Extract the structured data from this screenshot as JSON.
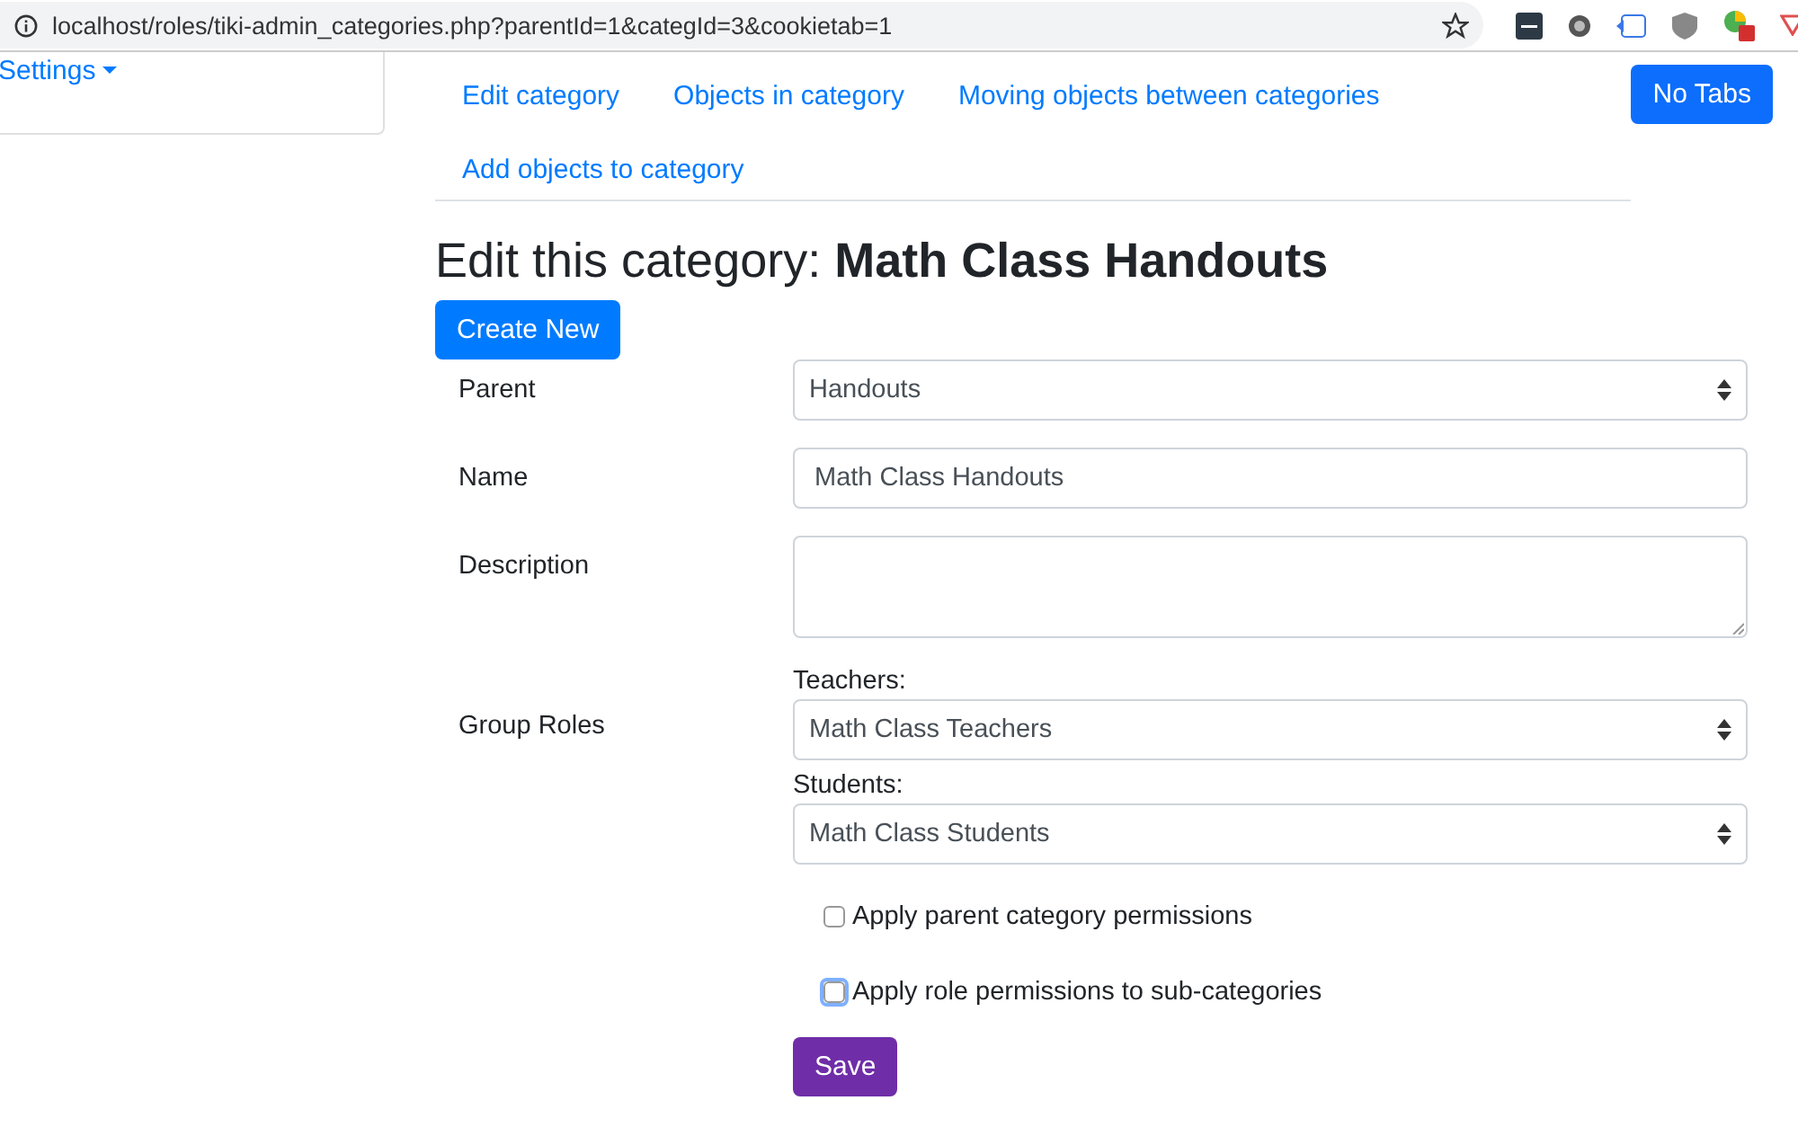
{
  "browser": {
    "url": "localhost/roles/tiki-admin_categories.php?parentId=1&categId=3&cookietab=1"
  },
  "sidebar": {
    "menu_label": "Settings"
  },
  "tabs": [
    {
      "label": "Edit category",
      "selected": false
    },
    {
      "label": "Objects in category",
      "selected": false
    },
    {
      "label": "Moving objects between categories",
      "selected": false
    },
    {
      "label": "Add objects to category",
      "selected": false
    }
  ],
  "no_tabs_button": "No Tabs",
  "heading": {
    "prefix": "Edit this category:",
    "name": "Math Class Handouts"
  },
  "create_button": "Create New",
  "form": {
    "parent": {
      "label": "Parent",
      "value": "Handouts"
    },
    "name": {
      "label": "Name",
      "value": "Math Class Handouts"
    },
    "description": {
      "label": "Description"
    },
    "group_roles": {
      "label": "Group Roles",
      "roles": [
        {
          "label": "Teachers:",
          "value": "Math Class Teachers"
        },
        {
          "label": "Students:",
          "value": "Math Class Students"
        }
      ]
    },
    "options": [
      {
        "label": "Apply parent category permissions",
        "checked": false,
        "focused": false
      },
      {
        "label": "Apply role permissions to sub-categories",
        "checked": false,
        "focused": true
      }
    ],
    "save_button": "Save"
  }
}
